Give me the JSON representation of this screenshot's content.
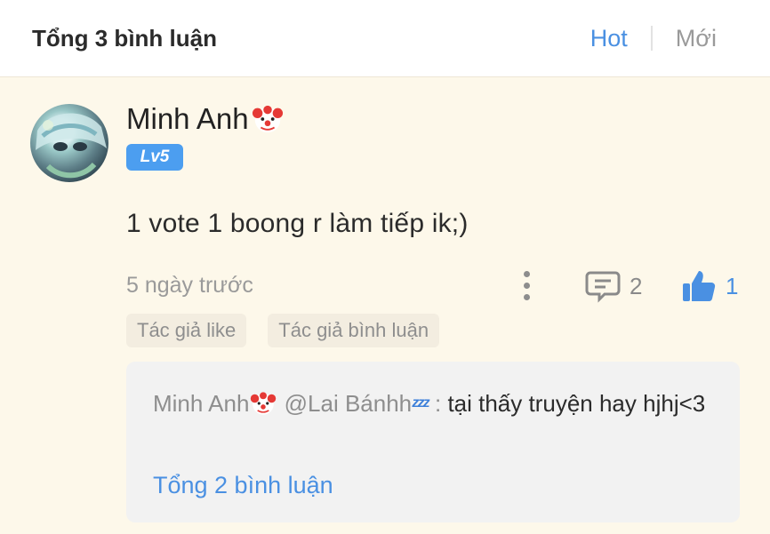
{
  "header": {
    "title": "Tổng 3 bình luận",
    "sort_hot": "Hot",
    "sort_new": "Mới"
  },
  "comment": {
    "username": "Minh Anh",
    "level": "Lv5",
    "text": "1 vote 1 boong r  làm tiếp ik;)",
    "time": "5 ngày trước",
    "reply_count": "2",
    "like_count": "1",
    "tags": [
      "Tác giả like",
      "Tác giả bình luận"
    ]
  },
  "reply": {
    "author": "Minh Anh",
    "mention": "@Lai Bánhh",
    "mention_emoji": "ᶻᶻᶻ",
    "separator": ":",
    "text": "tại thấy truyện hay hjhj<3",
    "total": "Tổng 2 bình luận"
  },
  "colors": {
    "accent": "#4a90e2",
    "panel_bg": "#fdf8ea",
    "badge": "#4c9ef0"
  }
}
